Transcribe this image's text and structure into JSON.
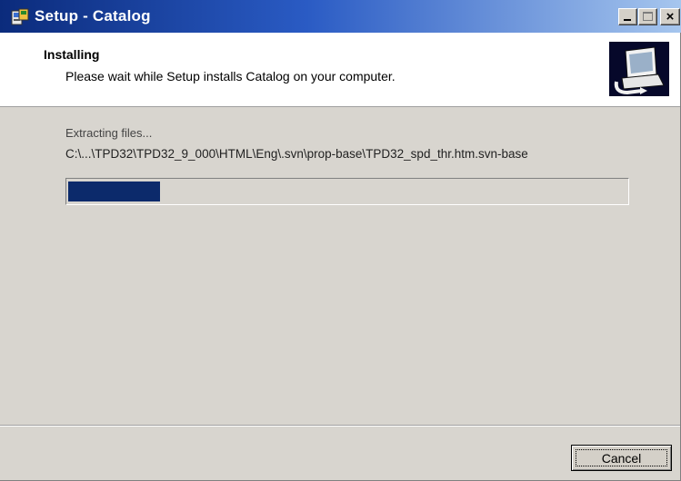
{
  "window": {
    "title": "Setup - Catalog",
    "colors": {
      "titlebar_start": "#0b2b7c",
      "titlebar_end": "#a6c6ee",
      "face": "#d8d5cf",
      "progress_fill": "#0c2a6b"
    },
    "icons": {
      "app": "setup-installer-icon",
      "minimize": "minimize-icon",
      "maximize": "maximize-icon",
      "close": "close-icon",
      "header_logo": "computer-install-icon"
    },
    "close_glyph": "×"
  },
  "header": {
    "title": "Installing",
    "subtitle": "Please wait while Setup installs Catalog on your computer."
  },
  "main": {
    "status": "Extracting files...",
    "current_file": "C:\\...\\TPD32\\TPD32_9_000\\HTML\\Eng\\.svn\\prop-base\\TPD32_spd_thr.htm.svn-base",
    "progress_fraction": 0.165
  },
  "footer": {
    "cancel_label": "Cancel"
  }
}
